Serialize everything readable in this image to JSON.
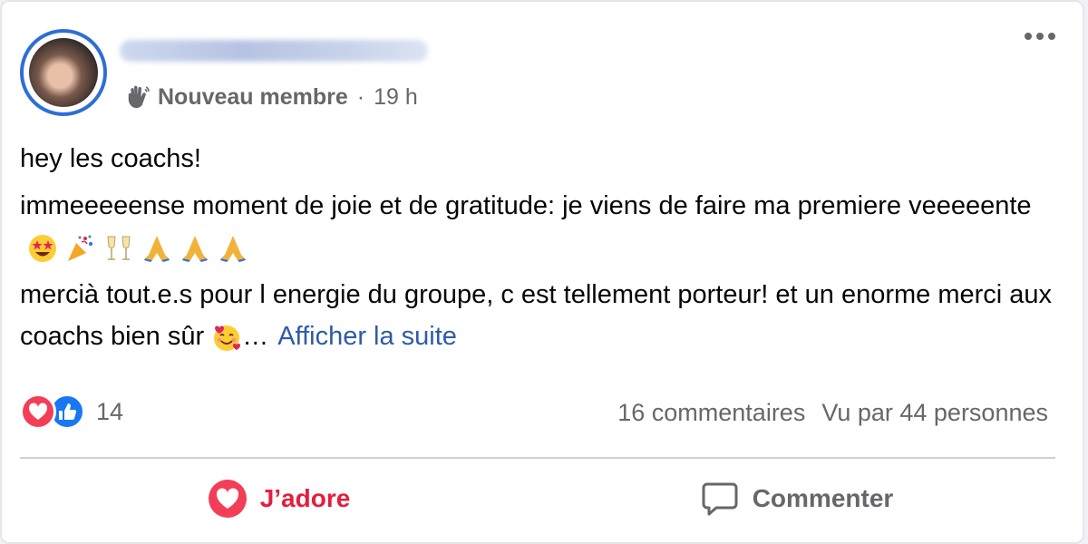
{
  "post": {
    "author_badge": "Nouveau membre",
    "separator": "·",
    "time": "19 h",
    "paragraphs": {
      "p1": "hey les coachs!",
      "p2_text": "immeeeeense moment de joie et de gratitude: je viens de faire ma premiere veeeeente",
      "p3_text": "mercià tout.e.s pour l energie du groupe, c est tellement porteur! et un enorme merci aux coachs bien sûr",
      "ellipsis": "…",
      "see_more": "Afficher la suite"
    },
    "emojis_p2": [
      "star-struck",
      "party-popper",
      "clinking-glasses",
      "folded-hands",
      "folded-hands",
      "folded-hands"
    ],
    "emoji_p3": "smiling-face-with-hearts"
  },
  "reactions": {
    "types": [
      "love",
      "like"
    ],
    "count": "14"
  },
  "stats": {
    "comments": "16 commentaires",
    "views": "Vu par 44 personnes"
  },
  "actions": {
    "love_label": "J’adore",
    "comment_label": "Commenter"
  },
  "colors": {
    "accent_blue": "#2d6fd6",
    "link": "#2d5ba8",
    "love": "#e41e3f",
    "muted": "#65676b"
  }
}
